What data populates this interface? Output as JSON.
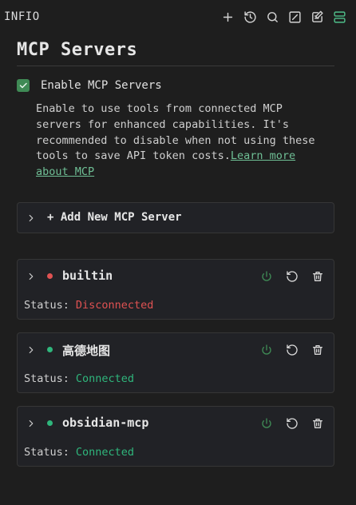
{
  "app": {
    "title": "INFIO"
  },
  "toolbar": {
    "icons": [
      "plus-icon",
      "history-icon",
      "search-icon",
      "edit-square-icon",
      "notebook-icon",
      "server-icon"
    ]
  },
  "page": {
    "title": "MCP Servers",
    "enable_label": "Enable MCP Servers",
    "enabled": true,
    "description": "Enable to use tools from connected MCP servers for enhanced capabilities. It's recommended to disable when not using these tools to save API token costs.",
    "learn_more": "Learn more about MCP"
  },
  "add_server": {
    "label": "+ Add New MCP Server"
  },
  "status_label": "Status:",
  "servers": [
    {
      "name": "builtin",
      "status": "Disconnected",
      "color": "#e05252"
    },
    {
      "name": "高德地图",
      "status": "Connected",
      "color": "#2fb67c"
    },
    {
      "name": "obsidian-mcp",
      "status": "Connected",
      "color": "#2fb67c"
    }
  ],
  "colors": {
    "accent": "#3f8a55",
    "connected": "#2fb67c",
    "disconnected": "#e05252",
    "link": "#6fbf95"
  }
}
